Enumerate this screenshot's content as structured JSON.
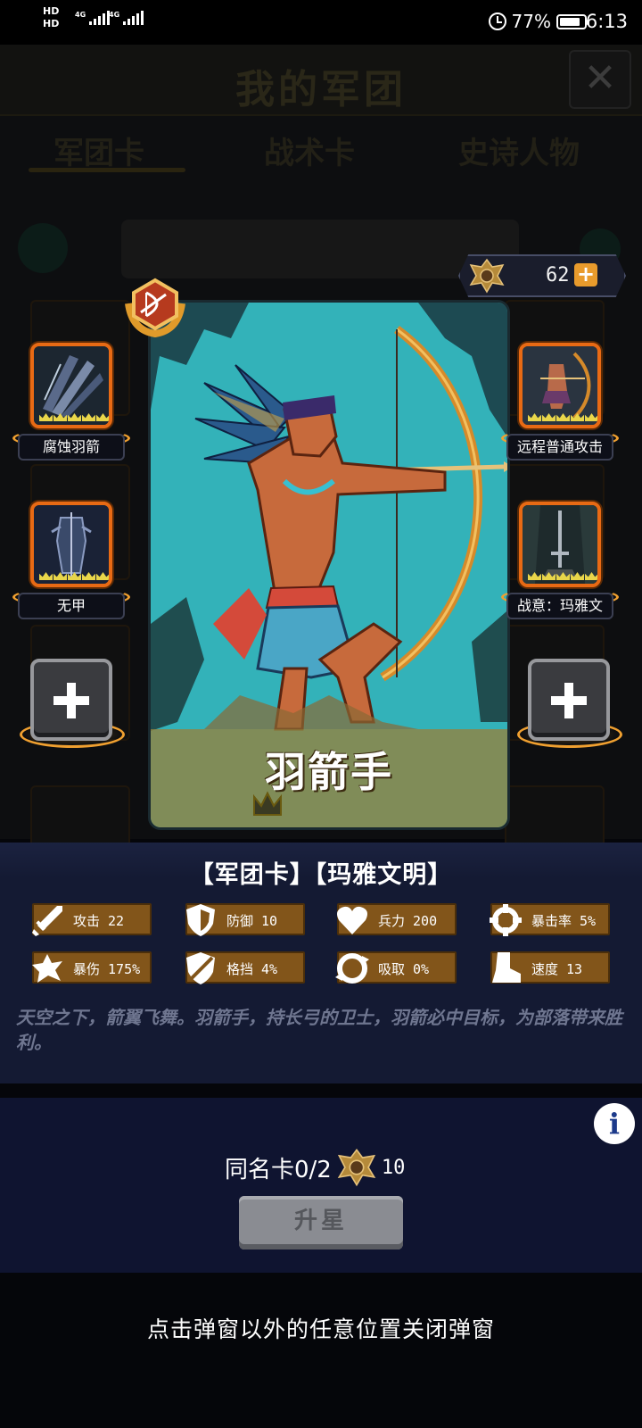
{
  "status_bar": {
    "left_top": "HD",
    "left_bottom": "HD",
    "network_1": "4G",
    "network_2": "4G",
    "battery": "77%",
    "time": "6:13"
  },
  "background": {
    "title": "我的军团",
    "tabs": [
      "军团卡",
      "战术卡",
      "史诗人物"
    ]
  },
  "currency": {
    "value": "62",
    "plus": "+"
  },
  "card": {
    "name": "羽箭手",
    "star_level": 1,
    "star_max": 5
  },
  "skills": [
    {
      "label": "腐蚀羽箭"
    },
    {
      "label": "远程普通攻击"
    },
    {
      "label": "无甲"
    },
    {
      "label": "战意：玛雅文"
    }
  ],
  "info": {
    "tags": "【军团卡】【玛雅文明】",
    "stats": [
      {
        "icon": "sword-icon",
        "text": "攻击 22"
      },
      {
        "icon": "shield-icon",
        "text": "防御 10"
      },
      {
        "icon": "heart-icon",
        "text": "兵力 200"
      },
      {
        "icon": "crosshair-icon",
        "text": "暴击率 5%"
      },
      {
        "icon": "burst-icon",
        "text": "暴伤 175%"
      },
      {
        "icon": "parry-icon",
        "text": "格挡 4%"
      },
      {
        "icon": "lifesteal-icon",
        "text": "吸取 0%"
      },
      {
        "icon": "boot-icon",
        "text": "速度 13"
      }
    ],
    "description": "天空之下，箭翼飞舞。羽箭手，持长弓的卫士，羽箭必中目标，为部落带来胜利。"
  },
  "upgrade": {
    "dup_label": "同名卡0/2",
    "cost": "10",
    "button": "升星"
  },
  "close_hint": "点击弹窗以外的任意位置关闭弹窗",
  "colors": {
    "accent": "#e86a14",
    "stat_bg": "#82551a",
    "panel": "#141a33",
    "card_sky": "#33b2b9"
  }
}
